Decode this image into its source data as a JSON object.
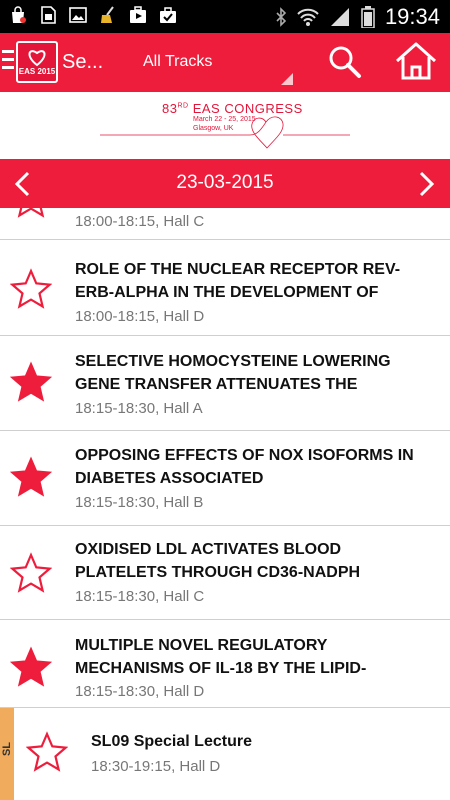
{
  "status_bar": {
    "time": "19:34",
    "left_icons": [
      "shopping-bag-icon",
      "sim-card-icon",
      "image-icon",
      "broom-icon",
      "play-store-icon",
      "briefcase-icon"
    ],
    "right_icons": [
      "bluetooth-icon",
      "wifi-icon",
      "signal-icon",
      "battery-icon"
    ]
  },
  "app_bar": {
    "title": "Se...",
    "track_filter": "All Tracks",
    "logo_text": "EAS 2015"
  },
  "banner": {
    "congress_number": "83",
    "congress_suffix": "RD",
    "congress_title": "EAS CONGRESS",
    "dates": "March 22 - 25, 2015",
    "city": "Glasgow, UK"
  },
  "date_nav": {
    "date": "23-03-2015"
  },
  "colors": {
    "brand_red": "#ee1d3c",
    "star_red": "#ee1d3c",
    "special_stripe": "#f0ab5c"
  },
  "sessions": [
    {
      "title": "",
      "meta": "18:00-18:15, Hall C",
      "favorited": false
    },
    {
      "title": "ROLE OF THE NUCLEAR RECEPTOR REV-ERB-ALPHA IN THE DEVELOPMENT OF",
      "meta": "18:00-18:15, Hall D",
      "favorited": false
    },
    {
      "title": "SELECTIVE HOMOCYSTEINE LOWERING GENE TRANSFER ATTENUATES THE",
      "meta": "18:15-18:30, Hall A",
      "favorited": true
    },
    {
      "title": "OPPOSING EFFECTS OF NOX ISOFORMS IN DIABETES ASSOCIATED",
      "meta": "18:15-18:30, Hall B",
      "favorited": true
    },
    {
      "title": "OXIDISED LDL ACTIVATES BLOOD PLATELETS THROUGH CD36-NADPH",
      "meta": "18:15-18:30, Hall C",
      "favorited": false
    },
    {
      "title": "MULTIPLE NOVEL REGULATORY MECHANISMS OF IL-18 BY THE LIPID-",
      "meta": "18:15-18:30, Hall D",
      "favorited": true
    },
    {
      "code": "SL",
      "title": "SL09 Special Lecture",
      "meta": "18:30-19:15, Hall D",
      "favorited": false
    }
  ]
}
